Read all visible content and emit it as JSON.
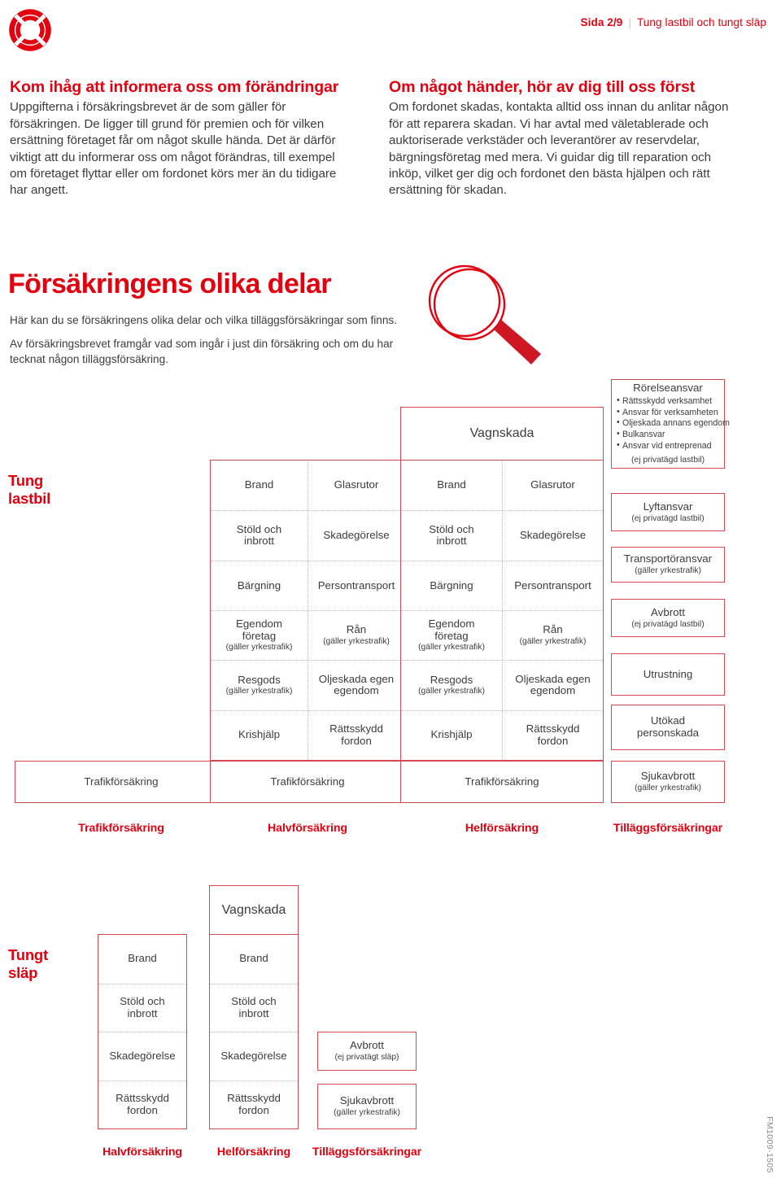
{
  "header": {
    "logo_icon": "lifebuoy-icon",
    "page_number": "Sida 2/9",
    "separator": "|",
    "doc_title": "Tung lastbil och tungt släp"
  },
  "intro": {
    "left": {
      "heading": "Kom ihåg att informera oss om förändringar",
      "body": "Uppgifterna i försäkringsbrevet är de som gäller för försäkringen. De ligger till grund för premien och för vilken ersättning företaget får om något skulle hända. Det är därför viktigt att du informerar oss om något förändras, till exempel om företaget flyttar eller om fordonet körs mer än du tidigare har angett."
    },
    "right": {
      "heading": "Om något händer, hör av dig till oss först",
      "body": "Om fordonet skadas, kontakta alltid oss innan du anlitar någon för att reparera skadan. Vi har avtal med väletablerade och auktoriserade verkstäder och leverantörer av reservdelar, bärgningsföretag med mera. Vi guidar dig till reparation och inköp, vilket ger dig och fordonet den bästa hjälpen och rätt ersättning för skadan."
    }
  },
  "section": {
    "title": "Försäkringens olika delar",
    "lead1": "Här kan du se försäkringens olika delar och vilka tilläggsförsäkringar som finns.",
    "lead2": "Av försäkringsbrevet framgår vad som ingår i just din försäkring och om du har tecknat någon tilläggsförsäkring.",
    "magnifier_icon": "magnifying-glass-icon"
  },
  "colors": {
    "brand_red": "#e3000f",
    "box_border": "#d4484f",
    "body_text": "#3c3c3b",
    "divider": "#bdbdbd"
  },
  "truck": {
    "row_label": "Tung lastbil",
    "vagnskada": "Vagnskada",
    "trafik": "Trafikförsäkring",
    "rows": [
      {
        "left": "Brand",
        "left_note": "",
        "right": "Glasrutor",
        "right_note": ""
      },
      {
        "left": "Stöld och\ninbrott",
        "left_note": "",
        "right": "Skadegörelse",
        "right_note": ""
      },
      {
        "left": "Bärgning",
        "left_note": "",
        "right": "Persontransport",
        "right_note": ""
      },
      {
        "left": "Egendom\nföretag",
        "left_note": "(gäller yrkestrafik)",
        "right": "Rån",
        "right_note": "(gäller yrkestrafik)"
      },
      {
        "left": "Resgods",
        "left_note": "(gäller yrkestrafik)",
        "right": "Oljeskada egen\negendom",
        "right_note": ""
      },
      {
        "left": "Krishjälp",
        "left_note": "",
        "right": "Rättsskydd\nfordon",
        "right_note": ""
      }
    ],
    "addons": [
      {
        "title": "Rörelseansvar",
        "bullets": [
          "Rättsskydd verksamhet",
          "Ansvar för verksamheten",
          "Oljeskada annans egendom",
          "Bulkansvar",
          "Ansvar vid entreprenad"
        ],
        "note": "(ej privatägd lastbil)"
      },
      {
        "title": "Lyftansvar",
        "bullets": [],
        "note": "(ej privatägd lastbil)"
      },
      {
        "title": "Transportöransvar",
        "bullets": [],
        "note": "(gäller yrkestrafik)"
      },
      {
        "title": "Avbrott",
        "bullets": [],
        "note": "(ej privatägd lastbil)"
      },
      {
        "title": "Utrustning",
        "bullets": [],
        "note": ""
      },
      {
        "title": "Utökad\npersonskada",
        "bullets": [],
        "note": ""
      },
      {
        "title": "Sjukavbrott",
        "bullets": [],
        "note": "(gäller yrkestrafik)"
      }
    ],
    "col_labels": [
      "Trafikförsäkring",
      "Halvförsäkring",
      "Helförsäkring",
      "Tilläggsförsäkringar"
    ]
  },
  "trailer": {
    "row_label": "Tungt släp",
    "vagnskada": "Vagnskada",
    "rows": [
      {
        "label": "Brand"
      },
      {
        "label": "Stöld och\ninbrott"
      },
      {
        "label": "Skadegörelse"
      },
      {
        "label": "Rättsskydd\nfordon"
      }
    ],
    "addons": [
      {
        "title": "Avbrott",
        "note": "(ej privatägt släp)"
      },
      {
        "title": "Sjukavbrott",
        "note": "(gäller yrkestrafik)"
      }
    ],
    "col_labels": [
      "Halvförsäkring",
      "Helförsäkring",
      "Tilläggsförsäkringar"
    ]
  },
  "footer": {
    "doc_code": "FM1009-1505"
  }
}
